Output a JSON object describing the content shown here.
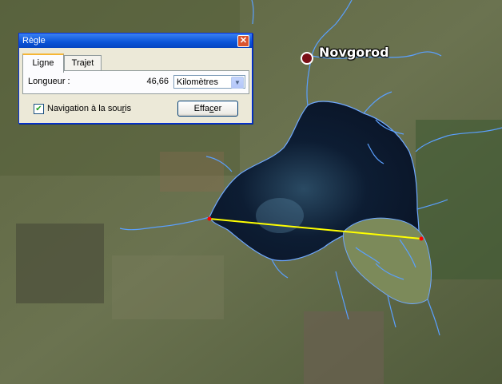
{
  "dialog": {
    "title": "Règle",
    "close_glyph": "✕",
    "tabs": [
      {
        "label": "Ligne",
        "active": true
      },
      {
        "label": "Trajet",
        "active": false
      }
    ],
    "length_label": "Longueur :",
    "length_value": "46,66",
    "unit_select": "Kilomètres",
    "mouse_nav_checked": true,
    "mouse_nav_label_pre": "Navigation à la sou",
    "mouse_nav_label_u": "r",
    "mouse_nav_label_post": "is",
    "clear_pre": "Effa",
    "clear_u": "c",
    "clear_post": "er"
  },
  "map": {
    "city": "Novgorod",
    "icons": [
      "city-marker-icon",
      "check-icon",
      "chevron-down-icon",
      "close-icon"
    ],
    "colors": {
      "water": "#0c1a2e",
      "rivers": "#5aa0ff",
      "ruler_line": "#ffff00",
      "endpoint": "#ff0000",
      "marker": "#7a0f16"
    }
  }
}
